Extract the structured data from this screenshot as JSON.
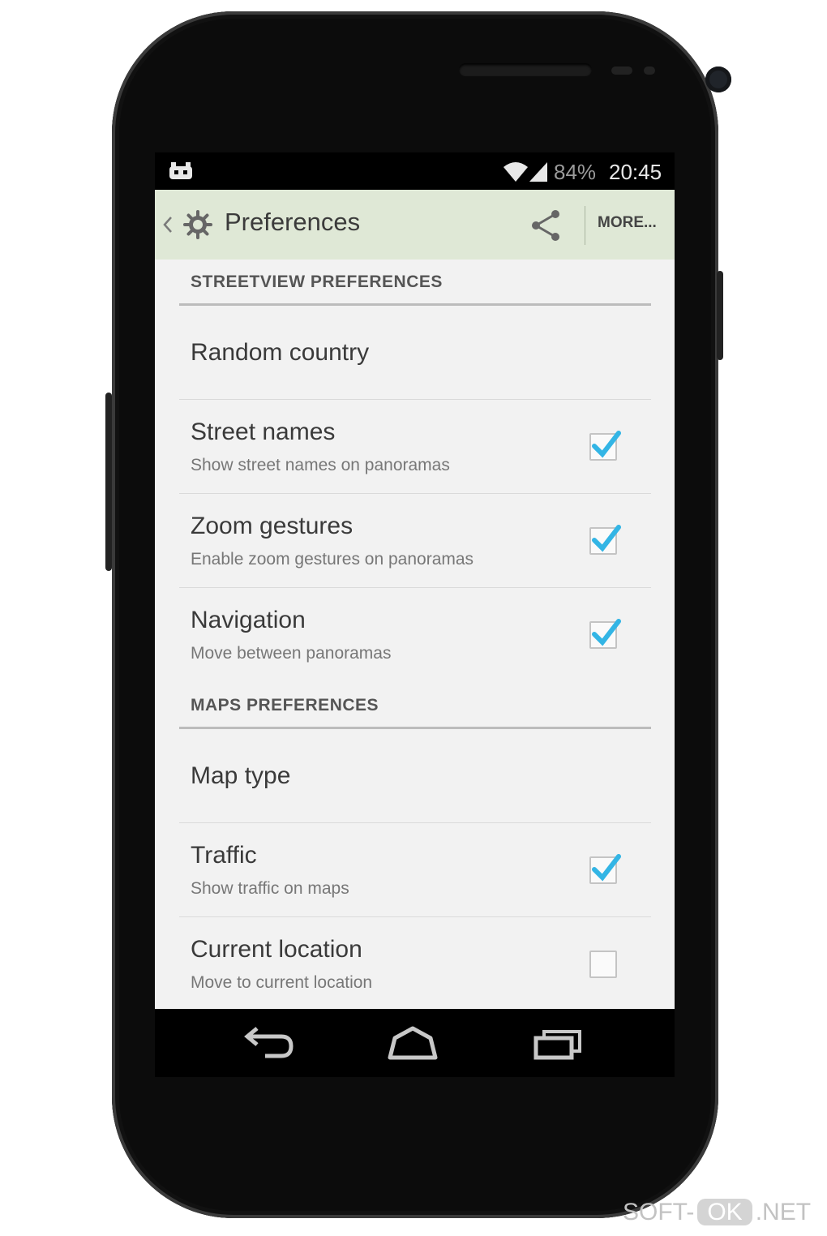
{
  "status_bar": {
    "battery": "84%",
    "time": "20:45"
  },
  "action_bar": {
    "title": "Preferences",
    "more_label": "MORE..."
  },
  "sections": [
    {
      "header": "STREETVIEW PREFERENCES",
      "items": [
        {
          "title": "Random country",
          "summary": null,
          "checkbox": null
        },
        {
          "title": "Street names",
          "summary": "Show street names on panoramas",
          "checkbox": true
        },
        {
          "title": "Zoom gestures",
          "summary": "Enable zoom gestures on panoramas",
          "checkbox": true
        },
        {
          "title": "Navigation",
          "summary": "Move between panoramas",
          "checkbox": true
        }
      ]
    },
    {
      "header": "MAPS PREFERENCES",
      "items": [
        {
          "title": "Map type",
          "summary": null,
          "checkbox": null
        },
        {
          "title": "Traffic",
          "summary": "Show traffic on maps",
          "checkbox": true
        },
        {
          "title": "Current location",
          "summary": "Move to current location",
          "checkbox": false
        }
      ]
    }
  ],
  "nav_bar": {
    "icons": [
      "back-icon",
      "home-icon",
      "recent-apps-icon"
    ]
  },
  "watermark": {
    "part1": "SOFT-",
    "part2": "OK",
    "part3": ".NET"
  },
  "colors": {
    "action_bar_bg": "#dfe8d6",
    "checkbox_check": "#33b5e5",
    "list_bg": "#f2f2f2"
  }
}
